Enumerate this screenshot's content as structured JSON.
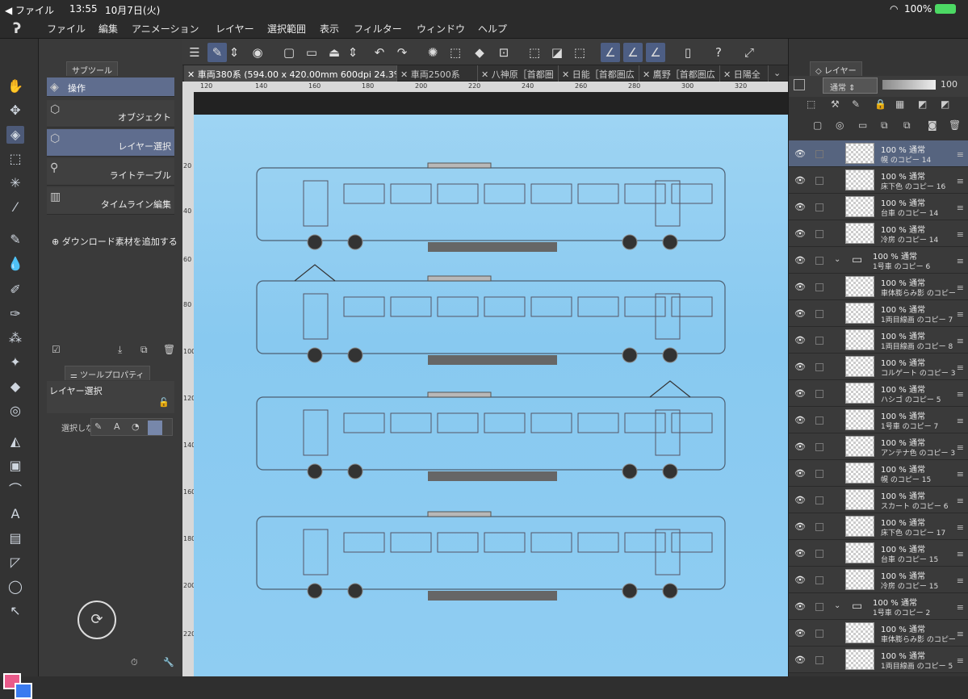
{
  "status": {
    "back": "◀ ファイル",
    "time": "13:55",
    "date": "10月7日(火)",
    "battery": "100%"
  },
  "menu": [
    "ファイル",
    "編集",
    "アニメーション",
    "レイヤー",
    "選択範囲",
    "表示",
    "フィルター",
    "ウィンドウ",
    "ヘルプ"
  ],
  "subtool": {
    "tab": "サブツール",
    "items": [
      "操作",
      "オブジェクト",
      "レイヤー選択",
      "ライトテーブル",
      "タイムライン編集"
    ],
    "download": "ダウンロード素材を追加する"
  },
  "toolprop": {
    "tab": "ツールプロパティ",
    "title": "レイヤー選択",
    "select_label": "選択しな"
  },
  "tabs": [
    "車両380系 (594.00 x 420.00mm 600dpi 24.3%)",
    "車両2500系",
    "八神原［首都圏",
    "日能［首都圏広",
    "鷹野［首都圏広",
    "日陽全"
  ],
  "ruler_h": [
    "120",
    "140",
    "160",
    "180",
    "200",
    "220",
    "240",
    "260",
    "280",
    "300",
    "320"
  ],
  "ruler_v": [
    "20",
    "40",
    "60",
    "80",
    "100",
    "120",
    "140",
    "160",
    "180",
    "200",
    "220"
  ],
  "layer_panel": {
    "tab": "レイヤー",
    "blend": "通常",
    "opacity": "100"
  },
  "layers": [
    {
      "t": "100 % 通常",
      "n": "幌 のコピー 14",
      "sel": true
    },
    {
      "t": "100 % 通常",
      "n": "床下色 のコピー 16"
    },
    {
      "t": "100 % 通常",
      "n": "台車 のコピー 14"
    },
    {
      "t": "100 % 通常",
      "n": "冷房 のコピー 14"
    },
    {
      "t": "100 % 通常",
      "n": "1号車 のコピー 6",
      "folder": true
    },
    {
      "t": "100 % 通常",
      "n": "車体膨らみ影 のコピー"
    },
    {
      "t": "100 % 通常",
      "n": "1両目線画 のコピー 7"
    },
    {
      "t": "100 % 通常",
      "n": "1両目線画 のコピー 8"
    },
    {
      "t": "100 % 通常",
      "n": "コルゲート のコピー 3"
    },
    {
      "t": "100 % 通常",
      "n": "ハシゴ のコピー 5"
    },
    {
      "t": "100 % 通常",
      "n": "1号車 のコピー 7"
    },
    {
      "t": "100 % 通常",
      "n": "アンテナ色 のコピー 3"
    },
    {
      "t": "100 % 通常",
      "n": "幌 のコピー 15"
    },
    {
      "t": "100 % 通常",
      "n": "スカート のコピー 6"
    },
    {
      "t": "100 % 通常",
      "n": "床下色 のコピー 17"
    },
    {
      "t": "100 % 通常",
      "n": "台車 のコピー 15"
    },
    {
      "t": "100 % 通常",
      "n": "冷房 のコピー 15"
    },
    {
      "t": "100 % 通常",
      "n": "1号車 のコピー 2",
      "folder": true
    },
    {
      "t": "100 % 通常",
      "n": "車体膨らみ影 のコピー"
    },
    {
      "t": "100 % 通常",
      "n": "1両目線画 のコピー 5"
    }
  ]
}
